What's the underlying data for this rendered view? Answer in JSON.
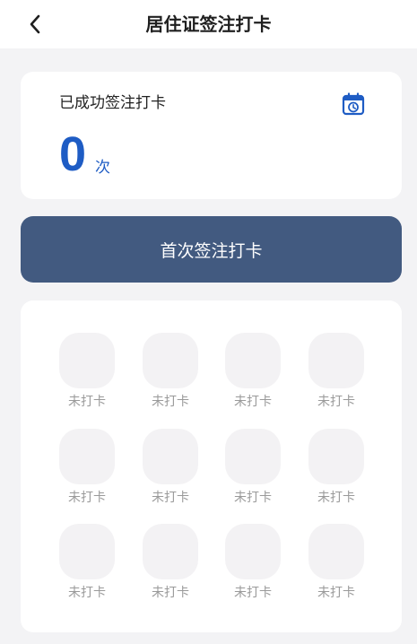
{
  "header": {
    "title": "居住证签注打卡"
  },
  "stats": {
    "label": "已成功签注打卡",
    "count": "0",
    "unit": "次"
  },
  "action": {
    "checkin_label": "首次签注打卡"
  },
  "grid": {
    "cells": [
      {
        "label": "未打卡"
      },
      {
        "label": "未打卡"
      },
      {
        "label": "未打卡"
      },
      {
        "label": "未打卡"
      },
      {
        "label": "未打卡"
      },
      {
        "label": "未打卡"
      },
      {
        "label": "未打卡"
      },
      {
        "label": "未打卡"
      },
      {
        "label": "未打卡"
      },
      {
        "label": "未打卡"
      },
      {
        "label": "未打卡"
      },
      {
        "label": "未打卡"
      }
    ]
  },
  "colors": {
    "accent_blue": "#1e5cc4",
    "button_bg": "#425a80",
    "page_bg": "#f3f3f5",
    "tile_bg": "#f3f2f4"
  },
  "icons": {
    "back": "chevron-left-icon",
    "calendar": "calendar-history-icon"
  }
}
